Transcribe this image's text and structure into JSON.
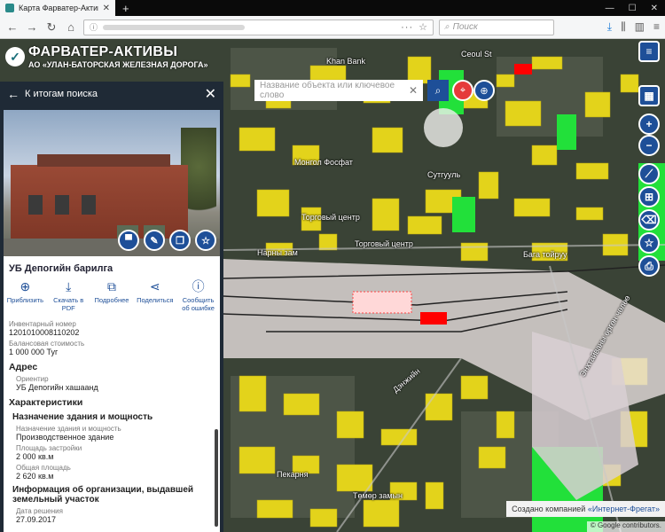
{
  "browser": {
    "tab_title": "Карта Фарватер-Активы",
    "search_placeholder": "Поиск"
  },
  "app": {
    "logo_title": "ФАРВАТЕР-АКТИВЫ",
    "logo_subtitle": "АО «УЛАН-БАТОРСКАЯ ЖЕЛЕЗНАЯ ДОРОГА»"
  },
  "panel": {
    "back_label": "К итогам поиска",
    "object_title": "УБ Депогийн барилга",
    "actions": [
      {
        "icon": "zoom-in-icon",
        "label": "Приблизить"
      },
      {
        "icon": "download-icon",
        "label": "Скачать в PDF"
      },
      {
        "icon": "external-link-icon",
        "label": "Подробнее"
      },
      {
        "icon": "share-icon",
        "label": "Поделиться"
      },
      {
        "icon": "alert-icon",
        "label": "Сообщить об ошибке"
      }
    ],
    "inventory_label": "Инвентарный номер",
    "inventory_value": "1201010008110202",
    "balance_label": "Балансовая стоимость",
    "balance_value": "1 000 000 Туг",
    "address_section": "Адрес",
    "landmark_label": "Ориентир",
    "landmark_value": "УБ Депогийн хашаанд",
    "characteristics_section": "Характеристики",
    "purpose_subsection": "Назначение здания и мощность",
    "purpose_label": "Назначение здания и мощность",
    "purpose_value": "Производственное здание",
    "built_area_label": "Площадь застройки",
    "built_area_value": "2 000 кв.м",
    "total_area_label": "Общая площадь",
    "total_area_value": "2 620 кв.м",
    "org_subsection": "Информация об организации, выдавшей земельный участок",
    "date_label": "Дата решения",
    "date_value": "27.09.2017"
  },
  "map": {
    "search_placeholder": "Название объекта или ключевое слово",
    "credit_prefix": "Создано компанией",
    "credit_company": "«Интернет-Фрегат»",
    "google_attr": "© Google contributors.",
    "labels": [
      "Khan Bank",
      "Сеоul St",
      "Монгол Фосфат",
      "Сутгууль",
      "Торговый центр",
      "Торговый центр",
      "Нарны зам",
      "Бага тойруу",
      "Пекарня",
      "Төмөр замын",
      "Энхтайваны өргөн чөлөө",
      "Дэнжийн"
    ],
    "colors": {
      "accent": "#1e4f98",
      "highlight_red": "#ff0000",
      "building_yellow": "#e3d31b",
      "park_green": "#22e03a"
    }
  }
}
